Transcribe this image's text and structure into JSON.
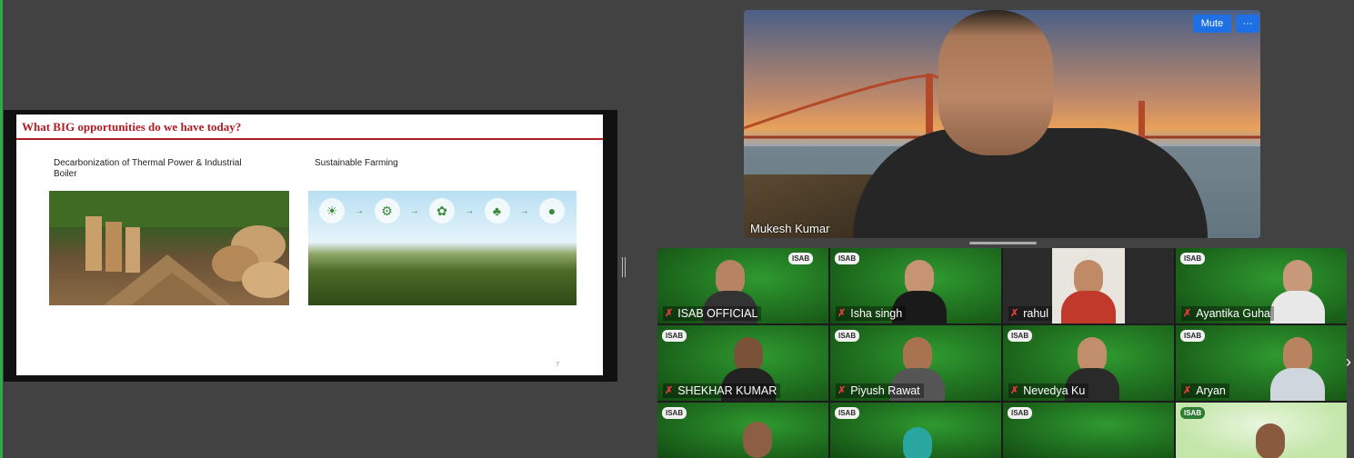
{
  "shared_slide": {
    "title": "What BIG opportunities do we have today?",
    "col1_caption": "Decarbonization of Thermal Power & Industrial Boiler",
    "col2_caption": "Sustainable Farming",
    "page_number": "7"
  },
  "speaker": {
    "name": "Mukesh Kumar",
    "mute_label": "Mute",
    "more_label": "···"
  },
  "gallery": {
    "participants": [
      {
        "name": "ISAB OFFICIAL",
        "logo": "ISAB"
      },
      {
        "name": "Isha singh",
        "logo": "ISAB"
      },
      {
        "name": "rahul",
        "logo": ""
      },
      {
        "name": "Ayantika Guha",
        "logo": "ISAB"
      },
      {
        "name": "SHEKHAR KUMAR",
        "logo": "ISAB"
      },
      {
        "name": "Piyush Rawat",
        "logo": "ISAB"
      },
      {
        "name": "Nevedya Ku",
        "logo": "ISAB"
      },
      {
        "name": "Aryan",
        "logo": "ISAB"
      },
      {
        "name": "",
        "logo": "ISAB"
      },
      {
        "name": "",
        "logo": "ISAB"
      },
      {
        "name": "",
        "logo": "ISAB"
      },
      {
        "name": "",
        "logo": "ISAB"
      }
    ],
    "extra_logo": "ISAB"
  },
  "icons": {
    "mic_muted": "mic-off-icon",
    "next_page": "chevron-right-icon"
  },
  "colors": {
    "background": "#424242",
    "accent_blue": "#1f6fe5",
    "slide_title": "#b01c24",
    "tile_green": "#1f6e1f"
  }
}
